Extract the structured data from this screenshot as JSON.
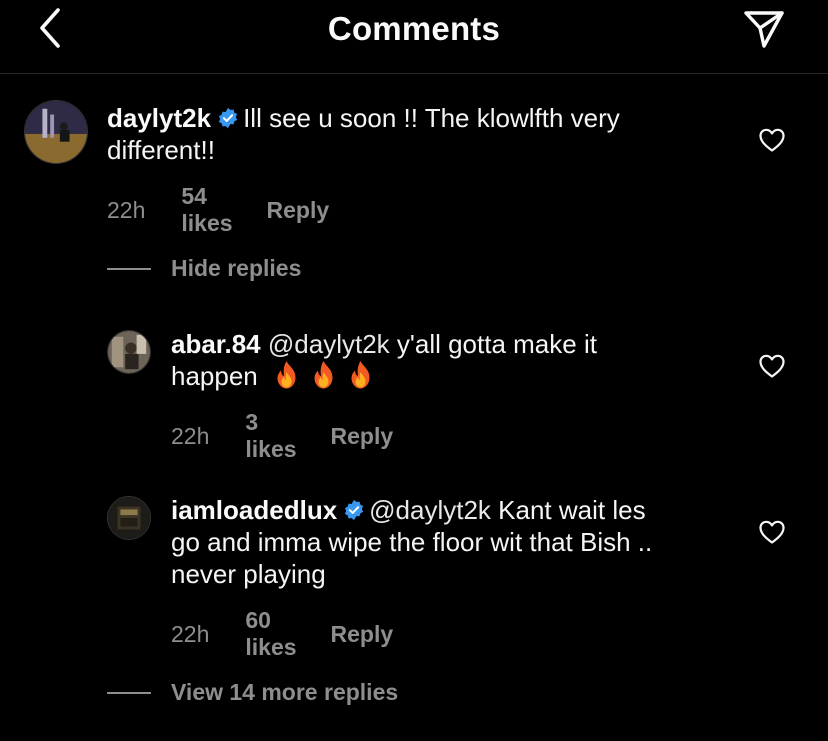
{
  "header": {
    "title": "Comments"
  },
  "comments": [
    {
      "username": "daylyt2k",
      "verified": true,
      "text": "Ill see  u soon !! The klowlfth very different!!",
      "time": "22h",
      "likes": "54 likes",
      "reply": "Reply"
    }
  ],
  "thread": {
    "hide_replies": "Hide replies",
    "view_more": "View 14 more replies"
  },
  "replies": [
    {
      "username": "abar.84",
      "verified": false,
      "mention": "@daylyt2k",
      "text_line1": "y'all gotta make it",
      "text_line2": "happen",
      "emoji": "🔥🔥🔥",
      "time": "22h",
      "likes": "3 likes",
      "reply": "Reply"
    },
    {
      "username": "iamloadedlux",
      "verified": true,
      "mention": "@daylyt2k",
      "text_line1": "Kant wait les",
      "text_line2": "go and imma wipe the floor wit that Bish ..",
      "text_line3": "never playing",
      "time": "22h",
      "likes": "60 likes",
      "reply": "Reply"
    }
  ],
  "colors": {
    "background": "#000000",
    "text": "#f5f5f5",
    "secondary": "#8e8e8e",
    "verified": "#3897f0",
    "divider": "#262626"
  },
  "icons": {
    "back": "chevron-left-icon",
    "share": "paper-plane-icon",
    "like": "heart-outline-icon",
    "verified": "verified-badge-icon",
    "fire": "fire-emoji"
  }
}
